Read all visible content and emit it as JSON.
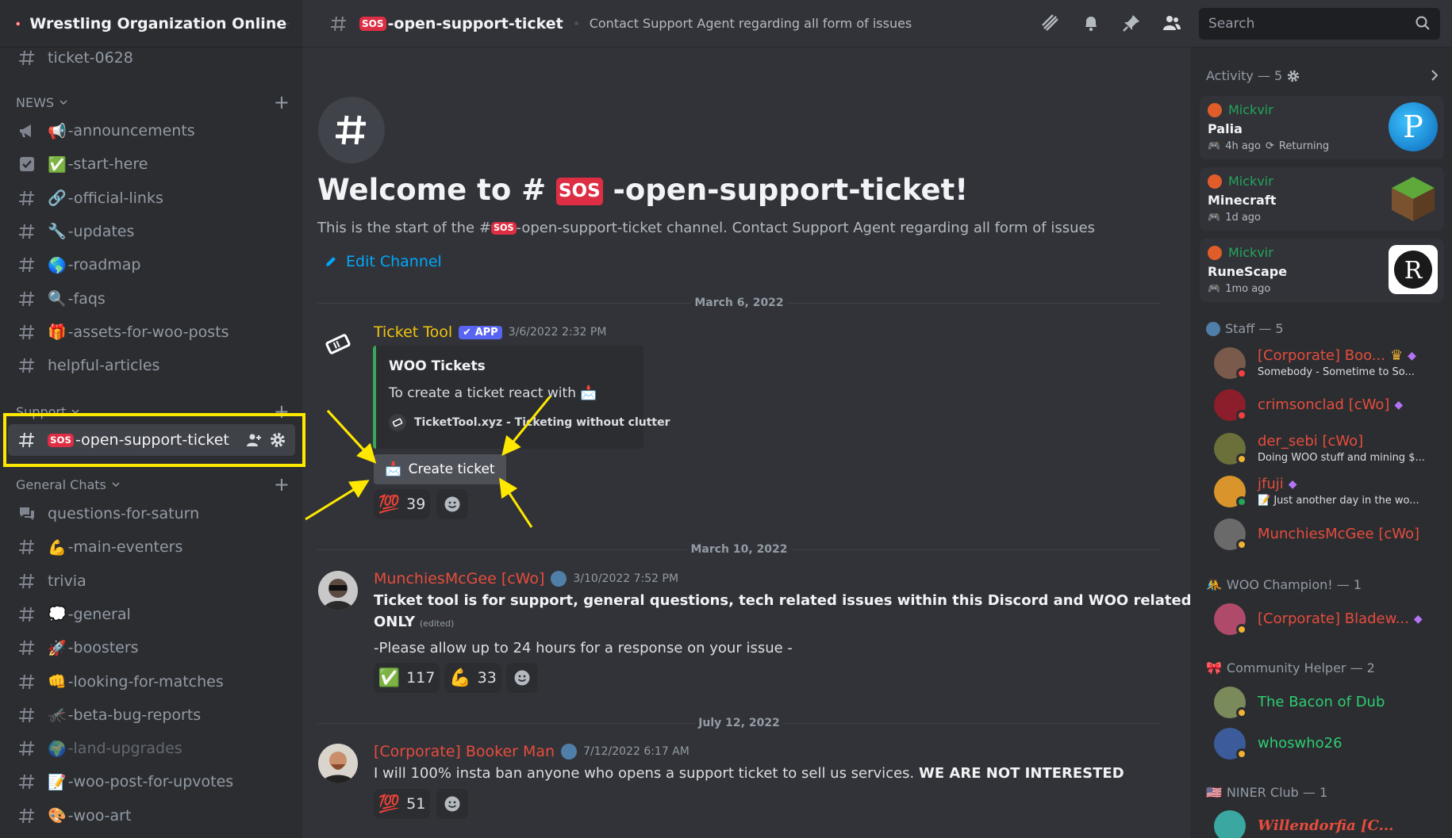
{
  "server": {
    "name": "Wrestling Organization Online"
  },
  "sidebar": {
    "top_channel": "ticket-0628",
    "categories": {
      "news": "NEWS",
      "support": "Support",
      "general": "General Chats"
    },
    "news_channels": [
      {
        "emoji": "📢",
        "label": "-announcements"
      },
      {
        "emoji": "✅",
        "label": "-start-here"
      },
      {
        "emoji": "🔗",
        "label": "-official-links"
      },
      {
        "emoji": "🔧",
        "label": "-updates"
      },
      {
        "emoji": "🌎",
        "label": "-roadmap"
      },
      {
        "emoji": "🔍",
        "label": "-faqs"
      },
      {
        "emoji": "🎁",
        "label": "-assets-for-woo-posts"
      },
      {
        "emoji": "",
        "label": "helpful-articles"
      }
    ],
    "support_channel": {
      "emoji": "SOS",
      "label": "-open-support-ticket"
    },
    "general_channels": [
      {
        "emoji": "",
        "label": "questions-for-saturn"
      },
      {
        "emoji": "💪",
        "label": "-main-eventers"
      },
      {
        "emoji": "",
        "label": "trivia"
      },
      {
        "emoji": "💭",
        "label": "-general"
      },
      {
        "emoji": "🚀",
        "label": "-boosters"
      },
      {
        "emoji": "👊",
        "label": "-looking-for-matches"
      },
      {
        "emoji": "🦟",
        "label": "-beta-bug-reports"
      },
      {
        "emoji": "🌍",
        "label": "-land-upgrades"
      },
      {
        "emoji": "📝",
        "label": "-woo-post-for-upvotes"
      },
      {
        "emoji": "🎨",
        "label": "-woo-art"
      }
    ]
  },
  "topbar": {
    "channel": "-open-support-ticket",
    "topic": "Contact Support Agent regarding all form of issues",
    "search_placeholder": "Search"
  },
  "welcome": {
    "title_prefix": "Welcome to #",
    "title_suffix": "-open-support-ticket!",
    "sub_prefix": "This is the start of the #",
    "sub_suffix": "-open-support-ticket channel. Contact Support Agent regarding all form of issues",
    "edit": "Edit Channel",
    "sos": "SOS"
  },
  "dates": [
    "March 6, 2022",
    "March 10, 2022",
    "July 12, 2022"
  ],
  "messages": {
    "m1": {
      "author": "Ticket Tool",
      "badge": "✔ APP",
      "time": "3/6/2022 2:32 PM",
      "embed_title": "WOO Tickets",
      "embed_desc": "To create a ticket react with",
      "embed_footer": "TicketTool.xyz - Ticketing without clutter",
      "button": "Create ticket",
      "reactions": [
        {
          "emoji": "💯",
          "count": "39"
        }
      ]
    },
    "m2": {
      "author": "MunchiesMcGee [cWo]",
      "time": "3/10/2022 7:52 PM",
      "line1": "Ticket tool is for support, general questions, tech related issues within this Discord and WOO related issues",
      "line2": "ONLY",
      "edited": "(edited)",
      "line3": "-Please allow up to 24 hours for a response on your issue -",
      "reactions": [
        {
          "emoji": "✅",
          "count": "117"
        },
        {
          "emoji": "💪",
          "count": "33"
        }
      ]
    },
    "m3": {
      "author": "[Corporate] Booker Man",
      "time": "7/12/2022 6:17 AM",
      "text": "I will 100% insta ban anyone who opens a support ticket to sell us services.",
      "text_bold": "WE ARE NOT INTERESTED",
      "reactions": [
        {
          "emoji": "💯",
          "count": "51"
        }
      ]
    }
  },
  "activity": {
    "header": "Activity — 5",
    "cards": [
      {
        "user": "Mickvir",
        "game": "Palia",
        "time": "4h ago",
        "extra": "Returning"
      },
      {
        "user": "Mickvir",
        "game": "Minecraft",
        "time": "1d ago",
        "extra": ""
      },
      {
        "user": "Mickvir",
        "game": "RuneScape",
        "time": "1mo ago",
        "extra": ""
      }
    ]
  },
  "members": {
    "staff_header": "Staff — 5",
    "staff": [
      {
        "name": "[Corporate] Boo...",
        "status": "Somebody - Sometime to So..."
      },
      {
        "name": "crimsonclad [cWo]",
        "status": ""
      },
      {
        "name": "der_sebi [cWo]",
        "status": "Doing WOO stuff and mining $..."
      },
      {
        "name": "jfuji",
        "status": "📝 Just another day in the wo..."
      },
      {
        "name": "MunchiesMcGee [cWo]",
        "status": ""
      }
    ],
    "champion_header": "WOO Champion! — 1",
    "champions": [
      {
        "name": "[Corporate] Bladew..."
      }
    ],
    "helper_header": "Community Helper — 2",
    "helpers": [
      {
        "name": "The Bacon of Dub"
      },
      {
        "name": "whoswho26"
      }
    ],
    "niner_header": "NINER Club — 1",
    "niner": [
      {
        "name": "Willendorfia [C..."
      }
    ]
  },
  "colors": {
    "accent": "#5865f2",
    "link": "#00a8fc",
    "highlight": "#ffe800",
    "staff_name": "#e74c3c",
    "helper_name": "#2ecc71",
    "ticket_tool": "#f1c40f"
  }
}
